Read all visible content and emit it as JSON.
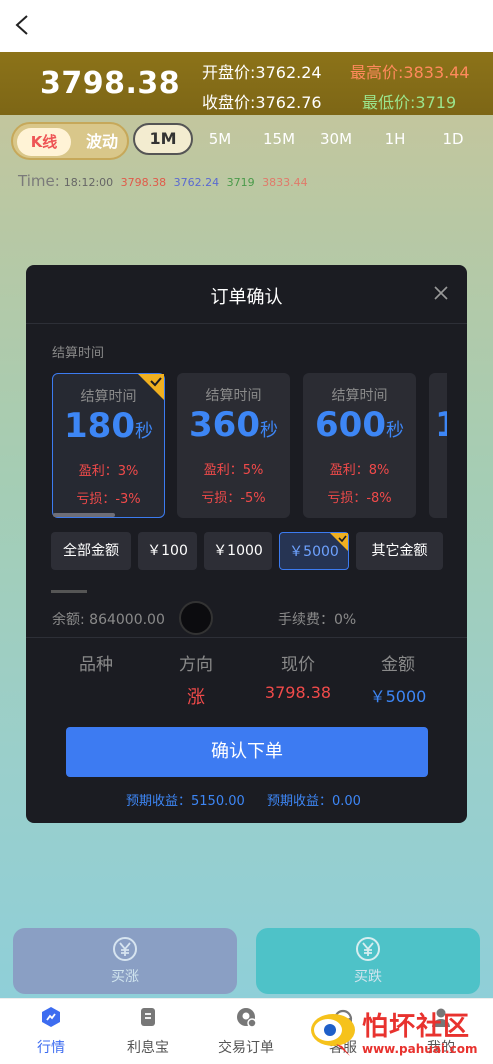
{
  "header": {
    "current_price": "3798.38",
    "open_label": "开盘价:",
    "open_value": "3762.24",
    "high_label": "最高价:",
    "high_value": "3833.44",
    "close_label": "收盘价:",
    "close_value": "3762.76",
    "low_label": "最低价:",
    "low_value": "3719"
  },
  "chart_tabs": {
    "kline": "K线",
    "wave": "波动",
    "timeframes": [
      "1M",
      "5M",
      "15M",
      "30M",
      "1H",
      "1D"
    ],
    "active": "1M"
  },
  "timeline": {
    "label": "Time:",
    "time": "18:12:00",
    "v1": "3798.38",
    "v2": "3762.24",
    "v3": "3719",
    "v4": "3833.44"
  },
  "modal": {
    "title": "订单确认",
    "settle_label": "结算时间",
    "cards": [
      {
        "label": "结算时间",
        "num": "180",
        "unit": "秒",
        "profit": "盈利：3%",
        "loss": "亏损：-3%"
      },
      {
        "label": "结算时间",
        "num": "360",
        "unit": "秒",
        "profit": "盈利：5%",
        "loss": "亏损：-5%"
      },
      {
        "label": "结算时间",
        "num": "600",
        "unit": "秒",
        "profit": "盈利：8%",
        "loss": "亏损：-8%"
      },
      {
        "label": "",
        "num": "1",
        "unit": "",
        "profit": "",
        "loss": ""
      }
    ],
    "amounts": [
      "全部金额",
      "￥100",
      "￥1000",
      "￥5000",
      "其它金额"
    ],
    "balance": "余额: 864000.00",
    "fee": "手续费：0%",
    "columns": {
      "variety": "品种",
      "direction": "方向",
      "price": "现价",
      "amount": "金额",
      "variety_value": "",
      "direction_value": "涨",
      "price_value": "3798.38",
      "amount_value": "￥5000"
    },
    "confirm": "确认下单",
    "expect1": "预期收益：5150.00",
    "expect2": "预期收益：0.00"
  },
  "actions": {
    "buy_up": "买涨",
    "buy_down": "买跌"
  },
  "tabbar": {
    "market": "行情",
    "interest": "利息宝",
    "orders": "交易订单",
    "service": "客服",
    "mine": "我的"
  },
  "watermark": {
    "text": "怕坏社区",
    "url": "www.pahuai.com"
  },
  "colors": {
    "accent": "#3d7bf2",
    "rise": "#f04a4a",
    "modal_bg": "#1b1c22"
  }
}
